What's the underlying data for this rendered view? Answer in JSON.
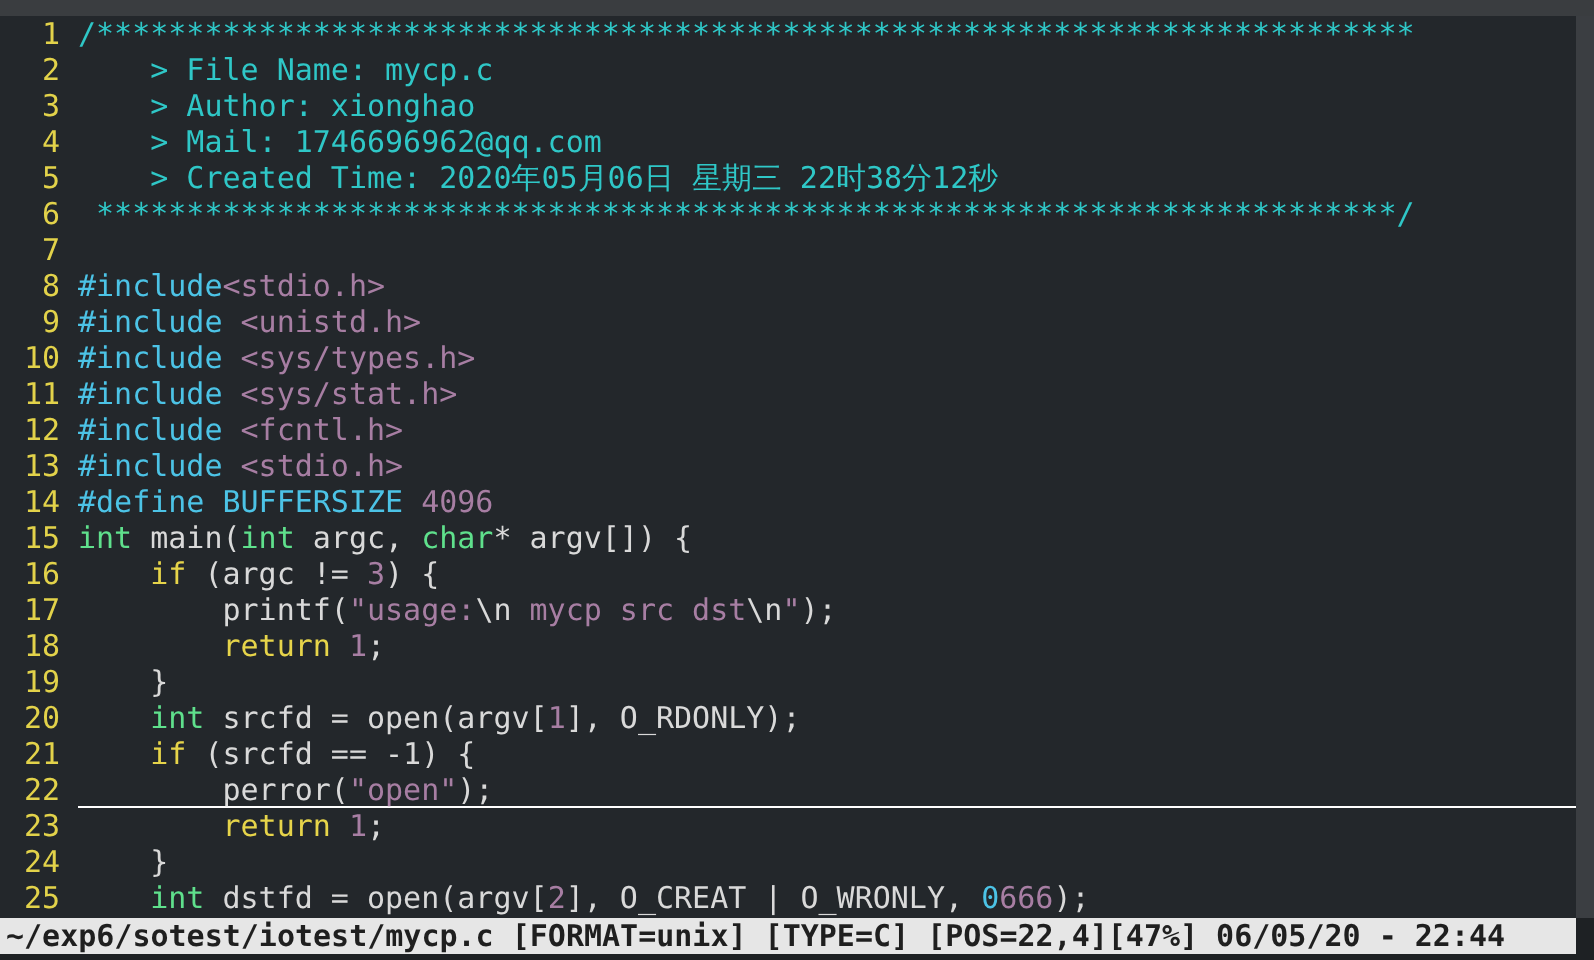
{
  "editor": {
    "lines": [
      {
        "number": "1",
        "cursor": false,
        "tokens": [
          {
            "kind": "comment",
            "text": "/*************************************************************************"
          }
        ]
      },
      {
        "number": "2",
        "cursor": false,
        "tokens": [
          {
            "kind": "comment",
            "text": "    > File Name: mycp.c"
          }
        ]
      },
      {
        "number": "3",
        "cursor": false,
        "tokens": [
          {
            "kind": "comment",
            "text": "    > Author: xionghao"
          }
        ]
      },
      {
        "number": "4",
        "cursor": false,
        "tokens": [
          {
            "kind": "comment",
            "text": "    > Mail: 1746696962@qq.com"
          }
        ]
      },
      {
        "number": "5",
        "cursor": false,
        "tokens": [
          {
            "kind": "comment",
            "text": "    > Created Time: 2020年05月06日 星期三 22时38分12秒"
          }
        ]
      },
      {
        "number": "6",
        "cursor": false,
        "tokens": [
          {
            "kind": "comment",
            "text": " ************************************************************************/"
          }
        ]
      },
      {
        "number": "7",
        "cursor": false
      },
      {
        "number": "8",
        "cursor": false,
        "tokens": [
          {
            "kind": "preproc",
            "text": "#include"
          },
          {
            "kind": "string",
            "text": "<stdio.h>"
          }
        ]
      },
      {
        "number": "9",
        "cursor": false,
        "tokens": [
          {
            "kind": "preproc",
            "text": "#include "
          },
          {
            "kind": "string",
            "text": "<unistd.h>"
          }
        ]
      },
      {
        "number": "10",
        "cursor": false,
        "tokens": [
          {
            "kind": "preproc",
            "text": "#include "
          },
          {
            "kind": "string",
            "text": "<sys/types.h>"
          }
        ]
      },
      {
        "number": "11",
        "cursor": false,
        "tokens": [
          {
            "kind": "preproc",
            "text": "#include "
          },
          {
            "kind": "string",
            "text": "<sys/stat.h>"
          }
        ]
      },
      {
        "number": "12",
        "cursor": false,
        "tokens": [
          {
            "kind": "preproc",
            "text": "#include "
          },
          {
            "kind": "string",
            "text": "<fcntl.h>"
          }
        ]
      },
      {
        "number": "13",
        "cursor": false,
        "tokens": [
          {
            "kind": "preproc",
            "text": "#include "
          },
          {
            "kind": "string",
            "text": "<stdio.h>"
          }
        ]
      },
      {
        "number": "14",
        "cursor": false,
        "tokens": [
          {
            "kind": "preproc",
            "text": "#define BUFFERSIZE "
          },
          {
            "kind": "number",
            "text": "4096"
          }
        ]
      },
      {
        "number": "15",
        "cursor": false,
        "tokens": [
          {
            "kind": "type",
            "text": "int"
          },
          {
            "kind": "plain",
            "text": " main("
          },
          {
            "kind": "type",
            "text": "int"
          },
          {
            "kind": "plain",
            "text": " argc, "
          },
          {
            "kind": "type",
            "text": "char"
          },
          {
            "kind": "plain",
            "text": "* argv[]) {"
          }
        ]
      },
      {
        "number": "16",
        "cursor": false,
        "tokens": [
          {
            "kind": "keyword",
            "text": "    if"
          },
          {
            "kind": "plain",
            "text": " (argc != "
          },
          {
            "kind": "number",
            "text": "3"
          },
          {
            "kind": "plain",
            "text": ") {"
          }
        ]
      },
      {
        "number": "17",
        "cursor": false,
        "tokens": [
          {
            "kind": "plain",
            "text": "        printf("
          },
          {
            "kind": "string",
            "text": "\"usage:"
          },
          {
            "kind": "plain",
            "text": "\\n"
          },
          {
            "kind": "string",
            "text": " mycp src dst"
          },
          {
            "kind": "plain",
            "text": "\\n"
          },
          {
            "kind": "string",
            "text": "\""
          },
          {
            "kind": "plain",
            "text": ");"
          }
        ]
      },
      {
        "number": "18",
        "cursor": false,
        "tokens": [
          {
            "kind": "keyword",
            "text": "        return"
          },
          {
            "kind": "number",
            "text": " 1"
          },
          {
            "kind": "plain",
            "text": ";"
          }
        ]
      },
      {
        "number": "19",
        "cursor": false,
        "tokens": [
          {
            "kind": "plain",
            "text": "    }"
          }
        ]
      },
      {
        "number": "20",
        "cursor": false,
        "tokens": [
          {
            "kind": "type",
            "text": "    int"
          },
          {
            "kind": "plain",
            "text": " srcfd = open(argv["
          },
          {
            "kind": "number",
            "text": "1"
          },
          {
            "kind": "plain",
            "text": "], O_RDONLY);"
          }
        ]
      },
      {
        "number": "21",
        "cursor": false,
        "tokens": [
          {
            "kind": "keyword",
            "text": "    if"
          },
          {
            "kind": "plain",
            "text": " (srcfd == -1) {"
          }
        ]
      },
      {
        "number": "22",
        "cursor": true,
        "tokens": [
          {
            "kind": "plain",
            "text": "        perror("
          },
          {
            "kind": "string",
            "text": "\"open\""
          },
          {
            "kind": "plain",
            "text": ");"
          }
        ]
      },
      {
        "number": "23",
        "cursor": false,
        "tokens": [
          {
            "kind": "keyword",
            "text": "        return"
          },
          {
            "kind": "number",
            "text": " 1"
          },
          {
            "kind": "plain",
            "text": ";"
          }
        ]
      },
      {
        "number": "24",
        "cursor": false,
        "tokens": [
          {
            "kind": "plain",
            "text": "    }"
          }
        ]
      },
      {
        "number": "25",
        "cursor": false,
        "tokens": [
          {
            "kind": "type",
            "text": "    int"
          },
          {
            "kind": "plain",
            "text": " dstfd = open(argv["
          },
          {
            "kind": "number",
            "text": "2"
          },
          {
            "kind": "plain",
            "text": "], O_CREAT | O_WRONLY, "
          },
          {
            "kind": "preproc",
            "text": "0"
          },
          {
            "kind": "number",
            "text": "666"
          },
          {
            "kind": "plain",
            "text": ");"
          }
        ]
      }
    ]
  },
  "status_bar": "~/exp6/sotest/iotest/mycp.c [FORMAT=unix] [TYPE=C] [POS=22,4][47%] 06/05/20 - 22:44"
}
